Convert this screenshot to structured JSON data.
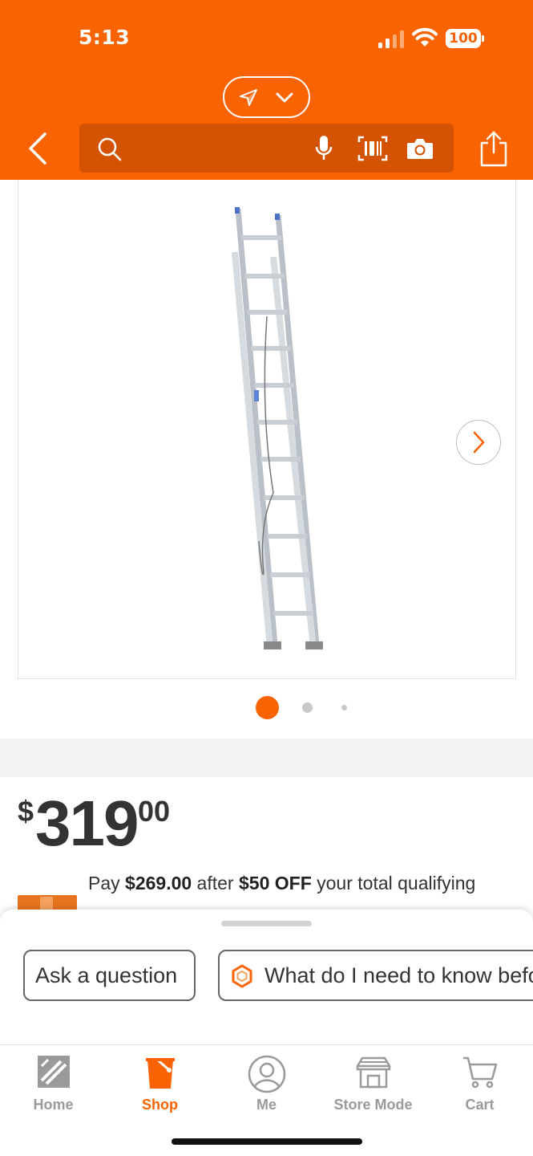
{
  "status_bar": {
    "time": "5:13",
    "battery": "100"
  },
  "header": {
    "background_color": "#f96302",
    "search": {
      "placeholder": ""
    },
    "icons": [
      "location-arrow-icon",
      "chevron-down-icon",
      "back-chevron-icon",
      "search-icon",
      "microphone-icon",
      "barcode-icon",
      "camera-icon",
      "share-icon"
    ]
  },
  "gallery": {
    "image_count": 3,
    "active_index": 0
  },
  "price": {
    "currency": "$",
    "dollars": "319",
    "cents": "00"
  },
  "promo": {
    "prefix": "Pay ",
    "amount": "$269.00",
    "middle": " after ",
    "discount": "$50 OFF",
    "suffix": " your total qualifying"
  },
  "bottom_sheet": {
    "ask_label": "Ask a question",
    "info_label": "What do I need to know before"
  },
  "tabbar": {
    "tabs": [
      {
        "label": "Home",
        "icon": "home-depot-logo-icon"
      },
      {
        "label": "Shop",
        "icon": "shop-bucket-icon"
      },
      {
        "label": "Me",
        "icon": "user-icon"
      },
      {
        "label": "Store Mode",
        "icon": "store-icon"
      },
      {
        "label": "Cart",
        "icon": "cart-icon"
      }
    ],
    "active": "Shop"
  }
}
